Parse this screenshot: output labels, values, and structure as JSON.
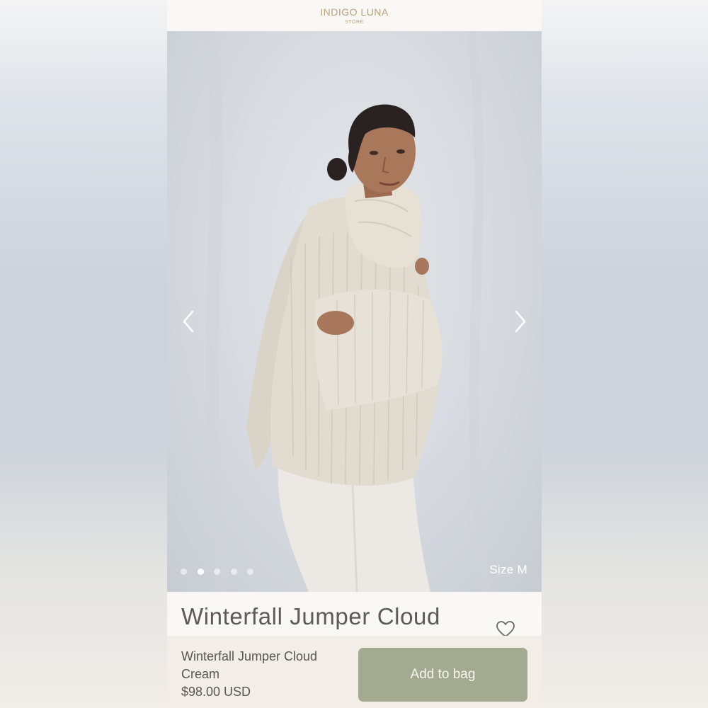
{
  "header": {
    "brand": "INDIGO LUNA",
    "brand_sub": "STORE"
  },
  "gallery": {
    "image_count": 5,
    "active_index": 1,
    "size_label": "Size M",
    "prev_icon": "chevron-left-icon",
    "next_icon": "chevron-right-icon"
  },
  "product": {
    "title": "Winterfall Jumper Cloud",
    "favorite_icon": "heart-icon"
  },
  "buybar": {
    "name": "Winterfall Jumper Cloud Cream",
    "price": "$98.00 USD",
    "add_label": "Add to bag"
  },
  "colors": {
    "brand": "#b8a27c",
    "button": "#a4aa90",
    "text": "#5a5550"
  }
}
